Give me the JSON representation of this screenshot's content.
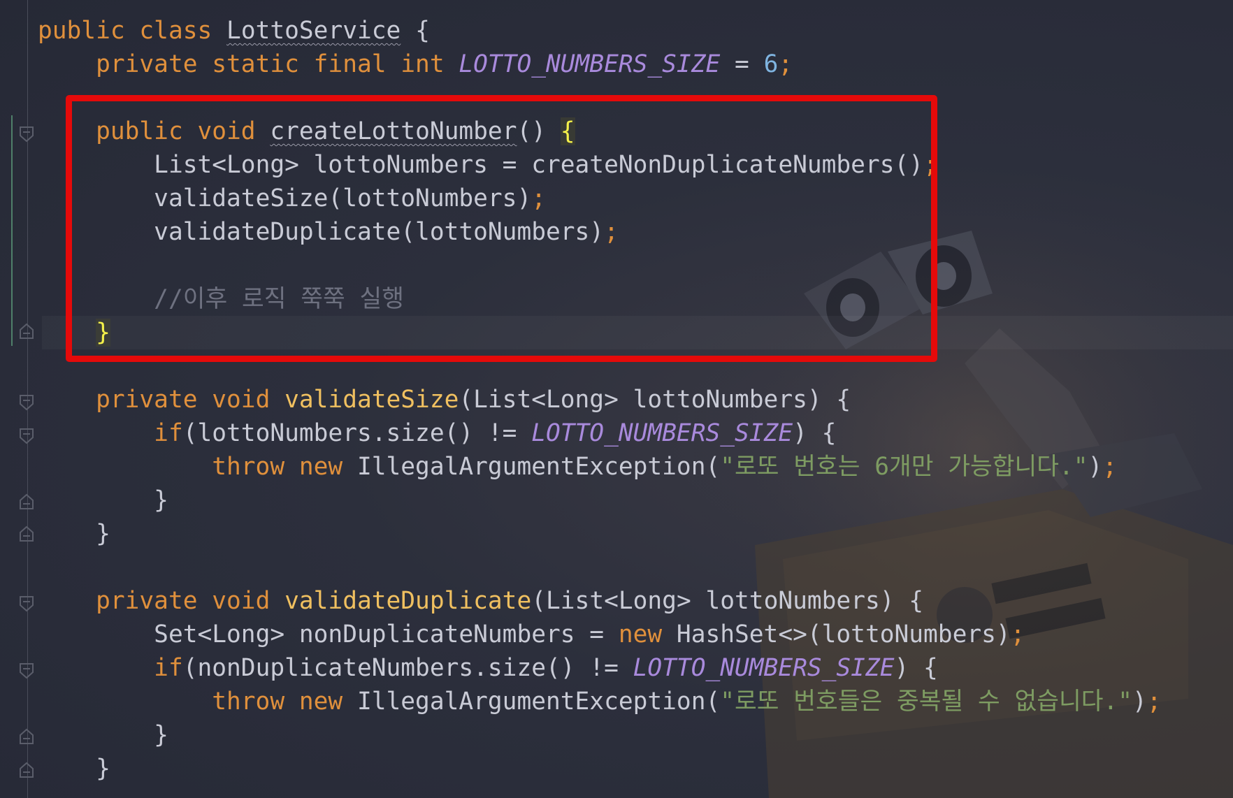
{
  "editor": {
    "theme_colors": {
      "keyword": "#e0903c",
      "function": "#f0c060",
      "constant": "#a98adc",
      "string": "#7e9c62",
      "comment": "#6e7180",
      "number": "#7fb4e0",
      "highlight_box": "#e50a0a"
    },
    "lines": {
      "l1": {
        "kw1": "public",
        "kw2": "class",
        "classname": "LottoService",
        "rest": " {"
      },
      "l2": {
        "mods": "private static final int",
        "const": "LOTTO_NUMBERS_SIZE",
        "eq": " = ",
        "num": "6",
        "semi": ";"
      },
      "l4": {
        "mods": "public void",
        "name": "createLottoNumber",
        "parens": "()",
        "brace": "{"
      },
      "l5": {
        "text": "List<Long> lottoNumbers = createNonDuplicateNumbers()",
        "semi": ";"
      },
      "l6": {
        "text": "validateSize(lottoNumbers)",
        "semi": ";"
      },
      "l7": {
        "text": "validateDuplicate(lottoNumbers)",
        "semi": ";"
      },
      "l9": {
        "comment": "//이후 로직 쭉쭉 실행"
      },
      "l10": {
        "brace": "}"
      },
      "l12": {
        "mods": "private void",
        "name": "validateSize",
        "params": "(List<Long> lottoNumbers) {"
      },
      "l13": {
        "kw": "if",
        "pre": "(lottoNumbers.size() != ",
        "const": "LOTTO_NUMBERS_SIZE",
        "post": ") {"
      },
      "l14": {
        "kw": "throw new",
        "cls": "IllegalArgumentException(",
        "str": "\"로또 번호는 6개만 가능합니다.\"",
        "close": ")",
        "semi": ";"
      },
      "l15": {
        "brace": "}"
      },
      "l16": {
        "brace": "}"
      },
      "l18": {
        "mods": "private void",
        "name": "validateDuplicate",
        "params": "(List<Long> lottoNumbers) {"
      },
      "l19": {
        "pre": "Set<Long> nonDuplicateNumbers = ",
        "kw": "new",
        "post": " HashSet<>(lottoNumbers)",
        "semi": ";"
      },
      "l20": {
        "kw": "if",
        "pre": "(nonDuplicateNumbers.size() != ",
        "const": "LOTTO_NUMBERS_SIZE",
        "post": ") {"
      },
      "l21": {
        "kw": "throw new",
        "cls": "IllegalArgumentException(",
        "str": "\"로또 번호들은 중복될 수 없습니다.\"",
        "close": ")",
        "semi": ";"
      },
      "l22": {
        "brace": "}"
      },
      "l23": {
        "brace": "}"
      }
    }
  }
}
